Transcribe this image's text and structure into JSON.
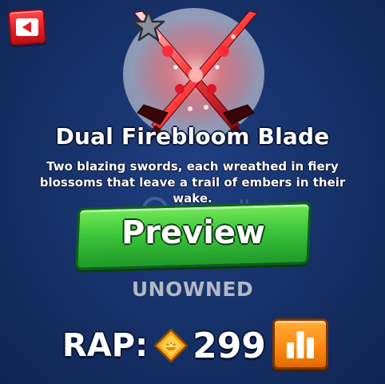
{
  "item": {
    "name": "Dual Firebloom Blade",
    "description": "Two blazing swords, each wreathed in fiery blossoms that leave a trail of embers in their wake.",
    "image_icon": "crossed-red-swords",
    "rarity_icon": "star-icon"
  },
  "back_button": {
    "icon": "back-arrow-icon"
  },
  "preview_button": {
    "label": "Preview"
  },
  "status": {
    "text": "UNOWNED"
  },
  "rap": {
    "label": "RAP:",
    "value": "299",
    "currency_icon": "diamond-coin-icon"
  },
  "stats_button": {
    "icon": "bar-chart-icon"
  },
  "watermark": {
    "text": "itemsdb"
  },
  "colors": {
    "background": "#17326a",
    "back_button": "#e11f25",
    "preview_button": "#3cc53a",
    "stats_button": "#ff8a12",
    "status_text": "#b3b8c4",
    "coin": "#f5a31a"
  }
}
